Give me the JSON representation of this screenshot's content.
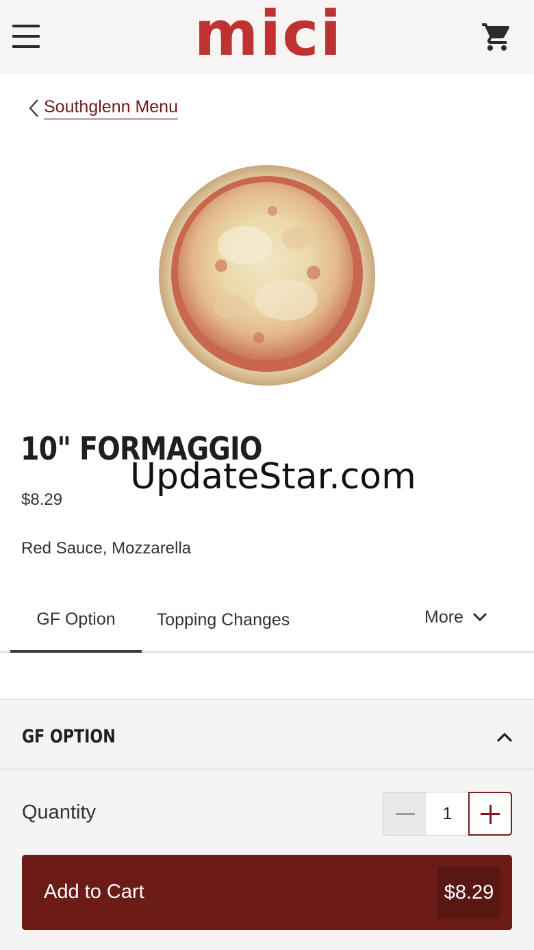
{
  "header": {
    "logo_text": "mici",
    "menu_icon": "hamburger-menu-icon",
    "cart_icon": "shopping-cart-icon",
    "brand_color": "#c03131"
  },
  "breadcrumb": {
    "back_label": "Southglenn Menu",
    "back_icon": "chevron-left-icon"
  },
  "product": {
    "image_alt": "Cheese pizza",
    "title": "10\" FORMAGGIO",
    "price": "$8.29",
    "description": "Red Sauce, Mozzarella"
  },
  "watermark": "UpdateStar.com",
  "tabs": [
    {
      "label": "GF Option",
      "active": true
    },
    {
      "label": "Topping Changes",
      "active": false
    }
  ],
  "more_tab": {
    "label": "More",
    "icon": "chevron-down-icon"
  },
  "section": {
    "title": "GF OPTION",
    "icon": "chevron-up-icon"
  },
  "quantity": {
    "label": "Quantity",
    "value": "1",
    "minus_icon": "minus-icon",
    "plus_icon": "plus-icon"
  },
  "add_to_cart": {
    "label": "Add to Cart",
    "price": "$8.29",
    "color": "#6b1c17"
  }
}
